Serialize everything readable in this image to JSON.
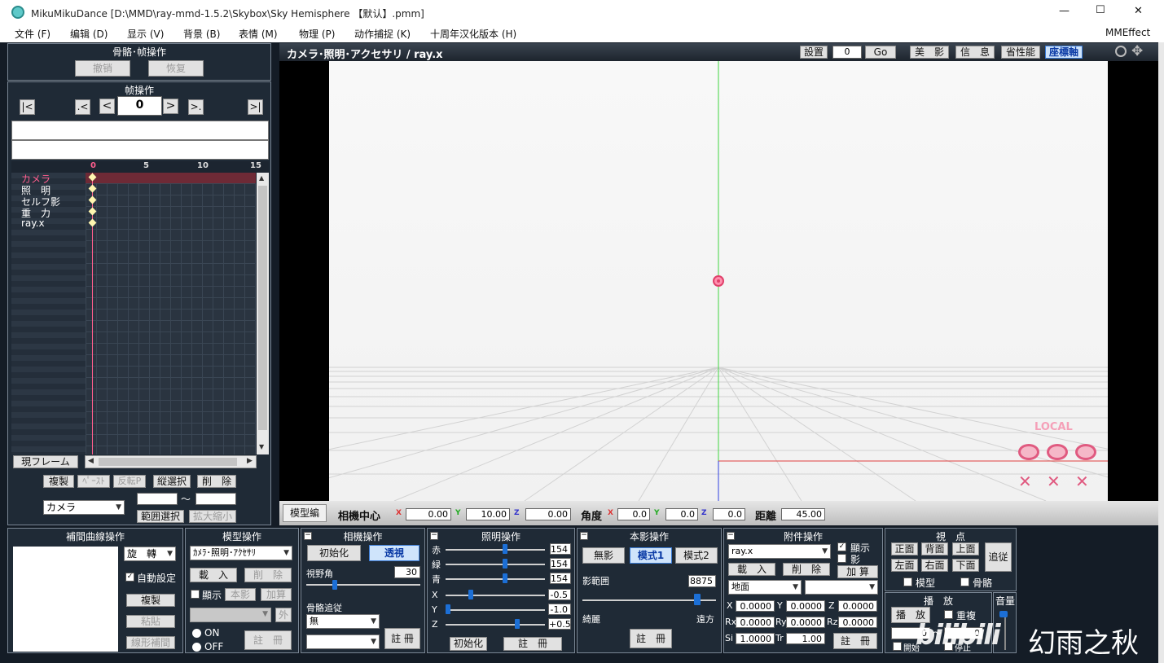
{
  "window": {
    "title": "MikuMikuDance [D:\\MMD\\ray-mmd-1.5.2\\Skybox\\Sky Hemisphere 【默认】.pmm]",
    "min": "—",
    "max": "☐",
    "close": "✕"
  },
  "menu": [
    "文件 (F)",
    "编辑 (D)",
    "显示 (V)",
    "背景 (B)",
    "表情 (M)",
    "物理 (P)",
    "动作捕捉 (K)",
    "十周年汉化版本 (H)"
  ],
  "menu_right": "MMEffect",
  "bone": {
    "title": "骨骼･帧操作",
    "undo": "撤销",
    "redo": "恢复"
  },
  "frame": {
    "title": "帧操作",
    "first": "|<",
    "prevkey": ".<",
    "prev": "<",
    "value": "0",
    "next": ">",
    "nextkey": ">.",
    "last": ">|"
  },
  "timeline": {
    "ticks": [
      "0",
      "5",
      "10",
      "15"
    ],
    "tracks": [
      "カメラ",
      "照　明",
      "セルフ影",
      "重　力",
      "ray.x"
    ],
    "current_frame": "現フレーム"
  },
  "tl_buttons": {
    "copy": "複製",
    "paste": "ﾍﾟｰｽﾄ",
    "reverse": "反転P",
    "vsel": "縦選択",
    "del": "削　除",
    "range": "範囲選択",
    "scale": "拡大縮小",
    "tilde": "～",
    "model": "カメラ"
  },
  "viewport": {
    "header": "カメラ･照明･アクセサリ / ray.x",
    "setting": "設置",
    "setting_val": "0",
    "go": "Go",
    "beauty": "美　影",
    "info": "信　息",
    "perf": "省性能",
    "axis": "座標軸",
    "local": "LOCAL"
  },
  "camera_bar": {
    "edit": "模型編",
    "center": "相機中心",
    "x": "0.00",
    "y": "10.00",
    "z": "0.00",
    "angle": "角度",
    "ax": "0.0",
    "ay": "0.0",
    "az": "0.0",
    "dist": "距離",
    "dist_val": "45.00"
  },
  "interp": {
    "title": "補間曲線操作",
    "rot": "旋　轉",
    "auto": "自動設定",
    "copy": "複製",
    "paste": "粘貼",
    "linear": "線形補間"
  },
  "model": {
    "title": "模型操作",
    "select": "ｶﾒﾗ･照明･ｱｸｾｻﾘ",
    "load": "載　入",
    "del": "削　除",
    "show": "顯示",
    "shadow": "本影",
    "add": "加算",
    "out": "外",
    "on": "ON",
    "off": "OFF",
    "reg": "註　冊"
  },
  "camera": {
    "title": "相機操作",
    "init": "初始化",
    "persp": "透視",
    "fov": "視野角",
    "fov_val": "30",
    "follow": "骨骼追従",
    "follow_val": "無",
    "reg": "註 冊"
  },
  "light": {
    "title": "照明操作",
    "r": "赤",
    "g": "緑",
    "b": "青",
    "rv": "154",
    "gv": "154",
    "bv": "154",
    "x": "X",
    "y": "Y",
    "z": "Z",
    "xv": "-0.5",
    "yv": "-1.0",
    "zv": "+0.5",
    "init": "初始化",
    "reg": "註　冊"
  },
  "shadow": {
    "title": "本影操作",
    "none": "無影",
    "mode1": "模式1",
    "mode2": "模式2",
    "range": "影範囲",
    "range_val": "8875",
    "near": "綺麗",
    "far": "遠方",
    "reg": "註　冊"
  },
  "acc": {
    "title": "附件操作",
    "select": "ray.x",
    "show": "顯示",
    "shadow": "影",
    "load": "載　入",
    "del": "削　除",
    "add": "加 算",
    "ground": "地面",
    "x": "0.0000",
    "y": "0.0000",
    "z": "0.0000",
    "rx": "0.0000",
    "ry": "0.0000",
    "rz": "0.0000",
    "si": "1.0000",
    "tr": "1.00",
    "reg": "註　冊",
    "lx": "X",
    "ly": "Y",
    "lz": "Z",
    "lrx": "Rx",
    "lry": "Ry",
    "lrz": "Rz",
    "lsi": "Si",
    "ltr": "Tr"
  },
  "view": {
    "title": "視　点",
    "front": "正面",
    "back": "背面",
    "top": "上面",
    "left": "左面",
    "right": "右面",
    "bottom": "下面",
    "follow": "追従",
    "model": "模型",
    "bone": "骨骼"
  },
  "play": {
    "title": "播　放",
    "play": "播　放",
    "repeat": "重複",
    "from": "0",
    "to": "0",
    "start": "開始",
    "stop": "停止",
    "volume": "音量"
  },
  "watermark": "幻雨之秋",
  "colors": {
    "panel": "#1f2a36",
    "accent_pink": "#ff5e8e",
    "blue": "#1c6fd6"
  }
}
